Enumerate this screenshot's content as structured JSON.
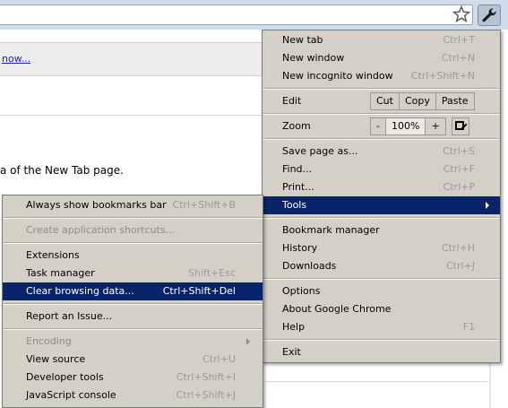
{
  "page": {
    "infobar_link": "now...",
    "text": "a of the New Tab page."
  },
  "icons": {
    "star": "star-icon",
    "wrench": "wrench-icon",
    "submenu_arrow": "chevron-right-icon"
  },
  "colors": {
    "menu_bg": "#d4d0c8",
    "highlight": "#0a246a",
    "toolbar": "#cfdcec"
  },
  "main_menu": {
    "new_tab": {
      "label": "New tab",
      "shortcut": "Ctrl+T"
    },
    "new_window": {
      "label": "New window",
      "shortcut": "Ctrl+N"
    },
    "new_incognito": {
      "label": "New incognito window",
      "shortcut": "Ctrl+Shift+N"
    },
    "edit": {
      "label": "Edit",
      "cut": "Cut",
      "copy": "Copy",
      "paste": "Paste"
    },
    "zoom": {
      "label": "Zoom",
      "minus": "-",
      "value": "100%",
      "plus": "+"
    },
    "save_page": {
      "label": "Save page as...",
      "shortcut": "Ctrl+S"
    },
    "find": {
      "label": "Find...",
      "shortcut": "Ctrl+F"
    },
    "print": {
      "label": "Print...",
      "shortcut": "Ctrl+P"
    },
    "tools": {
      "label": "Tools"
    },
    "bookmark_manager": {
      "label": "Bookmark manager"
    },
    "history": {
      "label": "History",
      "shortcut": "Ctrl+H"
    },
    "downloads": {
      "label": "Downloads",
      "shortcut": "Ctrl+J"
    },
    "options": {
      "label": "Options"
    },
    "about": {
      "label": "About Google Chrome"
    },
    "help": {
      "label": "Help",
      "shortcut": "F1"
    },
    "exit": {
      "label": "Exit"
    }
  },
  "tools_menu": {
    "always_show_bookmarks": {
      "label": "Always show bookmarks bar",
      "shortcut": "Ctrl+Shift+B"
    },
    "create_shortcuts": {
      "label": "Create application shortcuts..."
    },
    "extensions": {
      "label": "Extensions"
    },
    "task_manager": {
      "label": "Task manager",
      "shortcut": "Shift+Esc"
    },
    "clear_browsing": {
      "label": "Clear browsing data...",
      "shortcut": "Ctrl+Shift+Del"
    },
    "report_issue": {
      "label": "Report an Issue..."
    },
    "encoding": {
      "label": "Encoding"
    },
    "view_source": {
      "label": "View source",
      "shortcut": "Ctrl+U"
    },
    "developer_tools": {
      "label": "Developer tools",
      "shortcut": "Ctrl+Shift+I"
    },
    "javascript_console": {
      "label": "JavaScript console",
      "shortcut": "Ctrl+Shift+J"
    }
  }
}
